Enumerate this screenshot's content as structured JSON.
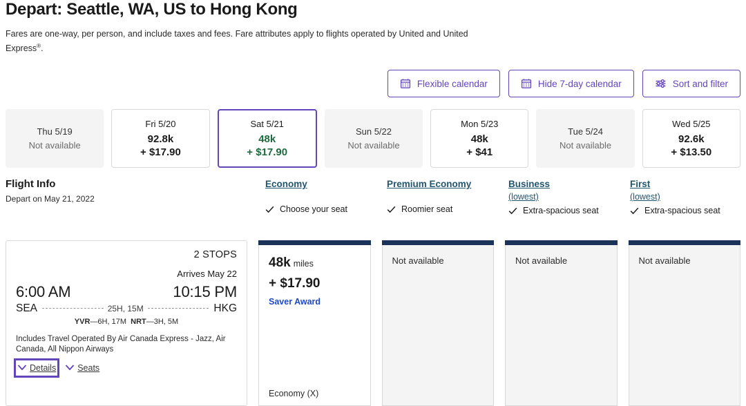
{
  "header": {
    "title": "Depart: Seattle, WA, US to Hong Kong",
    "subtitle_part1": "Fares are one-way, per person, and include taxes and fees. Fare attributes apply to flights operated by United and United Express",
    "subtitle_sup": "®",
    "subtitle_part2": "."
  },
  "toolbar": {
    "flexible_calendar": "Flexible calendar",
    "hide_7day_calendar": "Hide 7-day calendar",
    "sort_and_filter": "Sort and filter",
    "icons": {
      "flexible_calendar": "calendar-icon",
      "hide_7day_calendar": "calendar-icon",
      "sort_and_filter": "sliders-icon"
    }
  },
  "date_strip": [
    {
      "day": "Thu 5/19",
      "available": false,
      "na_label": "Not available",
      "miles": "",
      "price": "",
      "selected": false
    },
    {
      "day": "Fri 5/20",
      "available": true,
      "na_label": "",
      "miles": "92.8k",
      "price": "+ $17.90",
      "selected": false
    },
    {
      "day": "Sat 5/21",
      "available": true,
      "na_label": "",
      "miles": "48k",
      "price": "+ $17.90",
      "selected": true
    },
    {
      "day": "Sun 5/22",
      "available": false,
      "na_label": "Not available",
      "miles": "",
      "price": "",
      "selected": false
    },
    {
      "day": "Mon 5/23",
      "available": true,
      "na_label": "",
      "miles": "48k",
      "price": "+ $41",
      "selected": false
    },
    {
      "day": "Tue 5/24",
      "available": false,
      "na_label": "Not available",
      "miles": "",
      "price": "",
      "selected": false
    },
    {
      "day": "Wed 5/25",
      "available": true,
      "na_label": "",
      "miles": "92.6k",
      "price": "+ $13.50",
      "selected": false
    }
  ],
  "flight_info": {
    "title": "Flight Info",
    "depart_on": "Depart on May 21, 2022"
  },
  "cabins": [
    {
      "name": "Economy",
      "lowest": "",
      "feature": "Choose your seat"
    },
    {
      "name": "Premium Economy",
      "lowest": "",
      "feature": "Roomier seat"
    },
    {
      "name": "Business",
      "lowest": "(lowest)",
      "feature": "Extra-spacious seat"
    },
    {
      "name": "First",
      "lowest": "(lowest)",
      "feature": "Extra-spacious seat"
    }
  ],
  "flight": {
    "stops": "2 STOPS",
    "arrives": "Arrives May 22",
    "depart_time": "6:00 AM",
    "arrive_time": "10:15 PM",
    "origin": "SEA",
    "destination": "HKG",
    "duration": "25H, 15M",
    "layover1_code": "YVR",
    "layover1_dash": "—",
    "layover1_time": "6H, 17M",
    "layover2_code": "NRT",
    "layover2_dash": "—",
    "layover2_time": "3H, 5M",
    "operated_by": "Includes Travel Operated By Air Canada Express - Jazz, Air Canada, All Nippon Airways",
    "details_label": "Details",
    "seats_label": "Seats"
  },
  "fares": [
    {
      "available": true,
      "miles": "48k",
      "miles_unit": "miles",
      "price": "+ $17.90",
      "tag": "Saver Award",
      "fare_class": "Economy (X)",
      "na_label": ""
    },
    {
      "available": false,
      "miles": "",
      "miles_unit": "",
      "price": "",
      "tag": "",
      "fare_class": "",
      "na_label": "Not available"
    },
    {
      "available": false,
      "miles": "",
      "miles_unit": "",
      "price": "",
      "tag": "",
      "fare_class": "",
      "na_label": "Not available"
    },
    {
      "available": false,
      "miles": "",
      "miles_unit": "",
      "price": "",
      "tag": "",
      "fare_class": "",
      "na_label": "Not available"
    }
  ],
  "colors": {
    "accent_purple": "#6244bb",
    "link_teal": "#22556e",
    "selected_green": "#1c6b3f",
    "navy_bar": "#1b3358",
    "saver_blue": "#1f49c4"
  }
}
